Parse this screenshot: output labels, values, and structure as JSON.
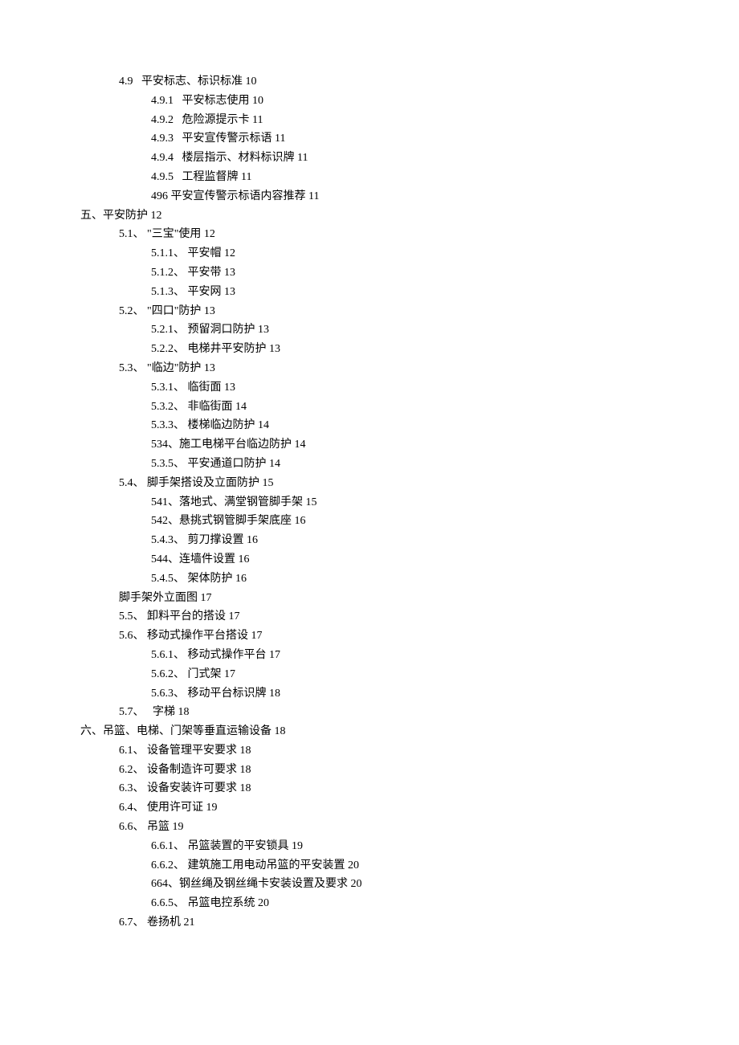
{
  "toc": [
    {
      "lvl": 2,
      "txt": "4.9   平安标志、标识标准 10"
    },
    {
      "lvl": 3,
      "txt": "4.9.1   平安标志使用 10"
    },
    {
      "lvl": 3,
      "txt": "4.9.2   危险源提示卡 11"
    },
    {
      "lvl": 3,
      "txt": "4.9.3   平安宣传警示标语 11"
    },
    {
      "lvl": 3,
      "txt": "4.9.4   楼层指示、材料标识牌 11"
    },
    {
      "lvl": 3,
      "txt": "4.9.5   工程监督牌 11"
    },
    {
      "lvl": 3,
      "txt": "496 平安宣传警示标语内容推荐 11"
    },
    {
      "lvl": 1,
      "txt": "五、平安防护 12"
    },
    {
      "lvl": 2,
      "txt": "5.1、 \"三宝\"使用 12"
    },
    {
      "lvl": 3,
      "txt": "5.1.1、 平安帽 12"
    },
    {
      "lvl": 3,
      "txt": "5.1.2、 平安带 13"
    },
    {
      "lvl": 3,
      "txt": "5.1.3、 平安网 13"
    },
    {
      "lvl": 2,
      "txt": "5.2、 \"四口\"防护 13"
    },
    {
      "lvl": 3,
      "txt": "5.2.1、 预留洞口防护 13"
    },
    {
      "lvl": 3,
      "txt": "5.2.2、 电梯井平安防护 13"
    },
    {
      "lvl": 2,
      "txt": "5.3、 \"临边\"防护 13"
    },
    {
      "lvl": 3,
      "txt": "5.3.1、 临街面 13"
    },
    {
      "lvl": 3,
      "txt": "5.3.2、 非临街面 14"
    },
    {
      "lvl": 3,
      "txt": "5.3.3、 楼梯临边防护 14"
    },
    {
      "lvl": 3,
      "txt": "534、施工电梯平台临边防护 14"
    },
    {
      "lvl": 3,
      "txt": "5.3.5、 平安通道口防护 14"
    },
    {
      "lvl": 2,
      "txt": "5.4、 脚手架搭设及立面防护 15"
    },
    {
      "lvl": 3,
      "txt": "541、落地式、满堂钢管脚手架 15"
    },
    {
      "lvl": 3,
      "txt": "542、悬挑式钢管脚手架底座 16"
    },
    {
      "lvl": 3,
      "txt": "5.4.3、 剪刀撑设置 16"
    },
    {
      "lvl": 3,
      "txt": "544、连墙件设置 16"
    },
    {
      "lvl": 3,
      "txt": "5.4.5、 架体防护 16"
    },
    {
      "lvl": 2,
      "txt": "脚手架外立面图 17"
    },
    {
      "lvl": 2,
      "txt": "5.5、 卸料平台的搭设 17"
    },
    {
      "lvl": 2,
      "txt": "5.6、 移动式操作平台搭设 17"
    },
    {
      "lvl": 3,
      "txt": "5.6.1、 移动式操作平台 17"
    },
    {
      "lvl": 3,
      "txt": "5.6.2、 门式架 17"
    },
    {
      "lvl": 3,
      "txt": "5.6.3、 移动平台标识牌 18"
    },
    {
      "lvl": 2,
      "txt": "5.7、   字梯 18"
    },
    {
      "lvl": 1,
      "txt": "六、吊篮、电梯、门架等垂直运输设备 18"
    },
    {
      "lvl": 2,
      "txt": "6.1、 设备管理平安要求 18"
    },
    {
      "lvl": 2,
      "txt": "6.2、 设备制造许可要求 18"
    },
    {
      "lvl": 2,
      "txt": "6.3、 设备安装许可要求 18"
    },
    {
      "lvl": 2,
      "txt": "6.4、 使用许可证 19"
    },
    {
      "lvl": 2,
      "txt": "6.6、 吊篮 19"
    },
    {
      "lvl": 3,
      "txt": "6.6.1、 吊篮装置的平安锁具 19"
    },
    {
      "lvl": 3,
      "txt": "6.6.2、 建筑施工用电动吊篮的平安装置 20"
    },
    {
      "lvl": 3,
      "txt": "664、钢丝绳及钢丝绳卡安装设置及要求 20"
    },
    {
      "lvl": 3,
      "txt": "6.6.5、 吊篮电控系统 20"
    },
    {
      "lvl": 2,
      "txt": "6.7、 卷扬机 21"
    }
  ]
}
